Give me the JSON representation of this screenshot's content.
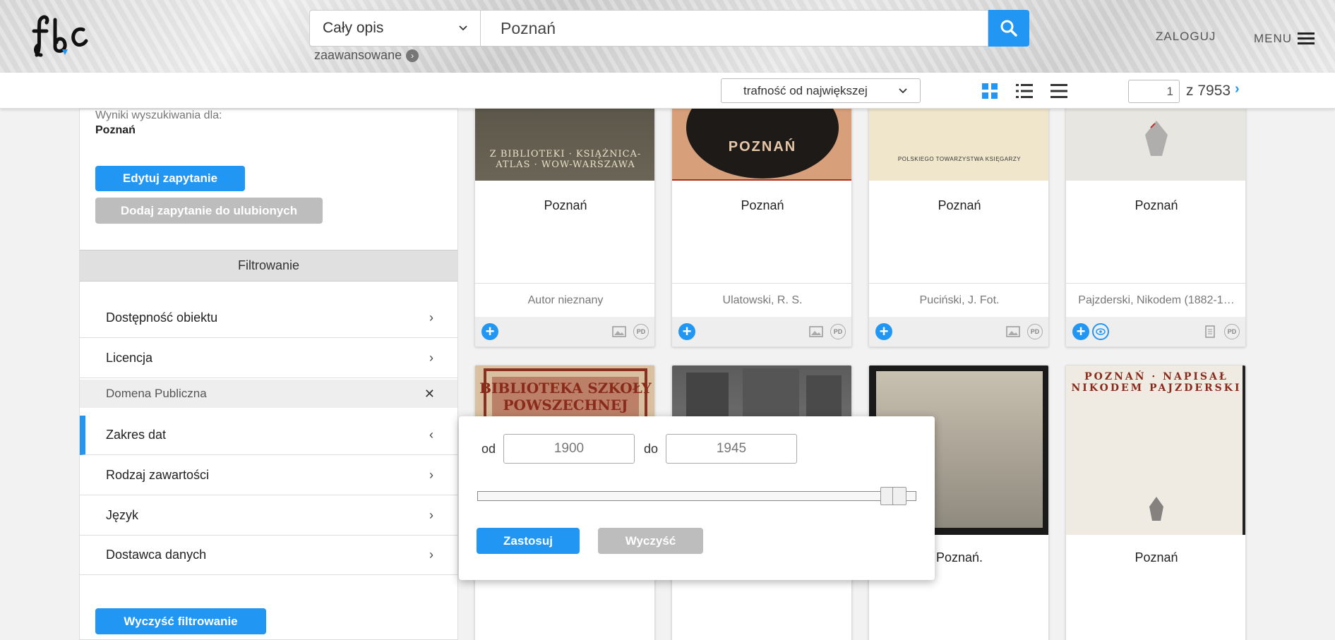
{
  "header": {
    "logo_text": "fbc",
    "search_scope": "Cały opis",
    "search_query": "Poznań",
    "advanced_label": "zaawansowane",
    "login_label": "ZALOGUJ",
    "menu_label": "MENU"
  },
  "toolbar": {
    "sort_value": "trafność od największej",
    "page_current": "1",
    "page_total": "z 7953"
  },
  "sidebar": {
    "results_label": "Wyniki wyszukiwania dla:",
    "results_query": "Poznań",
    "edit_query": "Edytuj zapytanie",
    "add_favorite": "Dodaj zapytanie do ulubionych",
    "filter_title": "Filtrowanie",
    "filters": [
      {
        "label": "Dostępność obiektu"
      },
      {
        "label": "Licencja"
      },
      {
        "label": "Zakres dat"
      },
      {
        "label": "Rodzaj zawartości"
      },
      {
        "label": "Język"
      },
      {
        "label": "Dostawca danych"
      }
    ],
    "active_sub": "Domena Publiczna",
    "clear_filters": "Wyczyść filtrowanie"
  },
  "cards": [
    {
      "title": "Poznań",
      "author": "Autor nieznany",
      "thumb_text": "Z BIBLIOTEKI · KSIĄŻNICA-ATLAS · WOW-WARSZAWA"
    },
    {
      "title": "Poznań",
      "author": "Ulatowski, R. S.",
      "thumb_text": "POZNAŃ"
    },
    {
      "title": "Poznań",
      "author": "Puciński, J. Fot.",
      "thumb_text": "POLSKIEGO TOWARZYSTWA KSIĘGARZY"
    },
    {
      "title": "Poznań",
      "author": "Pajzderski, Nikodem (1882-1…",
      "thumb_text": ""
    },
    {
      "title": "",
      "author": "",
      "thumb_text": "BIBLIOTEKA SZKOŁY POWSZECHNEJ"
    },
    {
      "title": "",
      "author": "",
      "thumb_text": ""
    },
    {
      "title": "Poznań.",
      "author": "",
      "thumb_text": ""
    },
    {
      "title": "Poznań",
      "author": "",
      "thumb_text": "POZNAŃ · NAPISAŁ NIKODEM PAJZDERSKI"
    }
  ],
  "date_popup": {
    "from_label": "od",
    "from_value": "1900",
    "to_label": "do",
    "to_value": "1945",
    "apply_label": "Zastosuj",
    "clear_label": "Wyczyść"
  },
  "colors": {
    "accent": "#2196f3",
    "muted_button": "#bdbdbd"
  }
}
